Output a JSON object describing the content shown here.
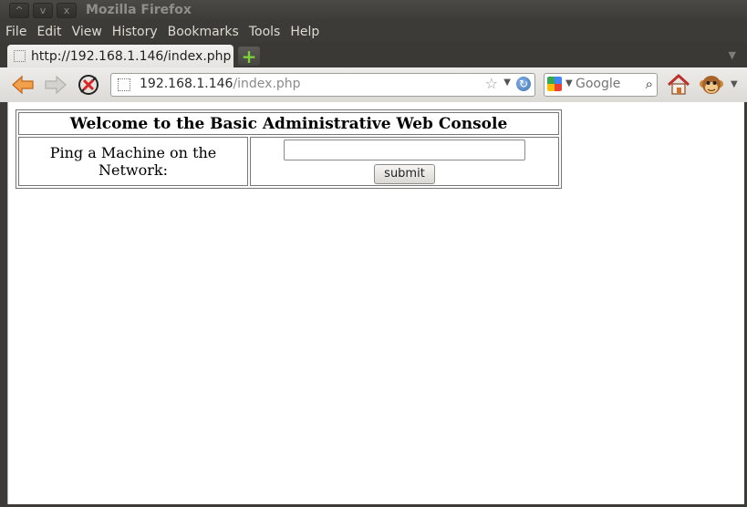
{
  "window": {
    "title": "Mozilla Firefox",
    "buttons": [
      "^",
      "v",
      "x"
    ]
  },
  "menu": [
    "File",
    "Edit",
    "View",
    "History",
    "Bookmarks",
    "Tools",
    "Help"
  ],
  "tab": {
    "title": "http://192.168.1.146/index.php"
  },
  "navbar": {
    "url_host": "192.168.1.146",
    "url_path": "/index.php",
    "search_placeholder": "Google"
  },
  "page": {
    "heading": "Welcome to the Basic Administrative Web Console",
    "ping_label": "Ping a Machine on the Network:",
    "ping_value": "",
    "submit_label": "submit"
  },
  "colors": {
    "chrome_dark": "#3c3b37",
    "menu_text": "#dfdbd2",
    "new_tab_plus": "#7cd03a"
  }
}
